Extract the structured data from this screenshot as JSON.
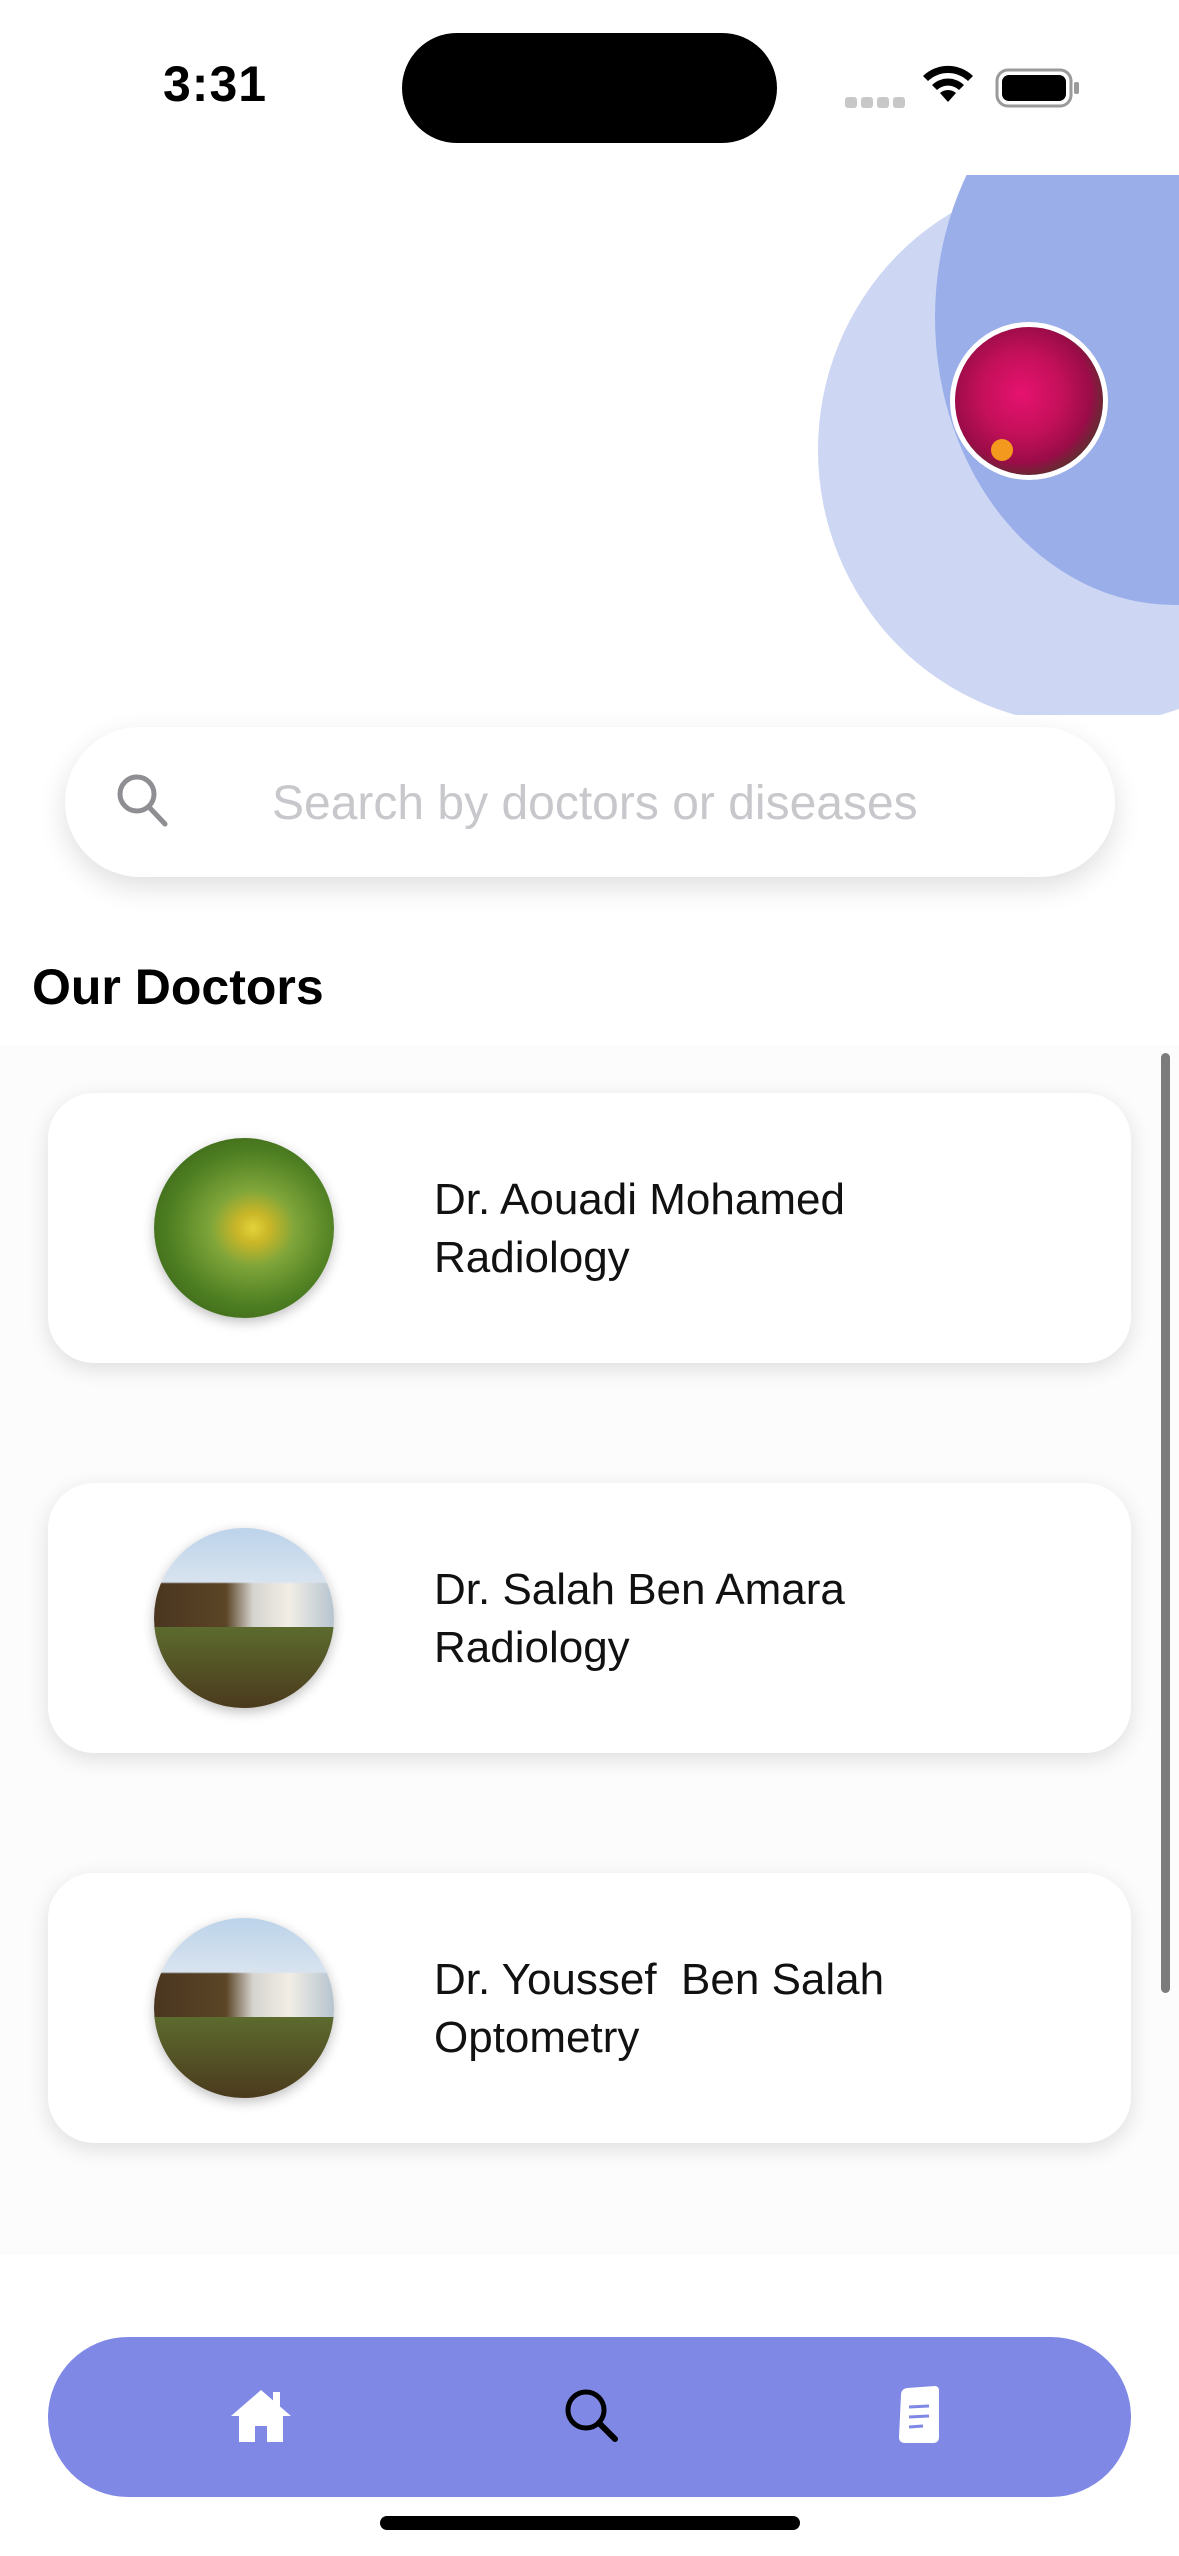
{
  "status_bar": {
    "time": "3:31"
  },
  "search": {
    "placeholder": "Search by doctors or diseases",
    "value": ""
  },
  "section": {
    "title": "Our Doctors"
  },
  "doctors": [
    {
      "name": "Dr. Aouadi Mohamed",
      "specialty": "Radiology",
      "photo": "leaf-photo"
    },
    {
      "name": "Dr. Salah Ben Amara",
      "specialty": "Radiology",
      "photo": "waterfall-photo"
    },
    {
      "name": "Dr. Youssef  Ben Salah",
      "specialty": "Optometry",
      "photo": "waterfall-photo"
    }
  ],
  "nav": {
    "items": [
      {
        "icon": "home-icon"
      },
      {
        "icon": "search-icon"
      },
      {
        "icon": "document-icon"
      }
    ]
  },
  "colors": {
    "nav_bar": "#7f88e5",
    "header_circle_light": "#cdd7f4",
    "header_circle_dark": "#9aaeea",
    "search_placeholder": "#c7c7cc"
  }
}
